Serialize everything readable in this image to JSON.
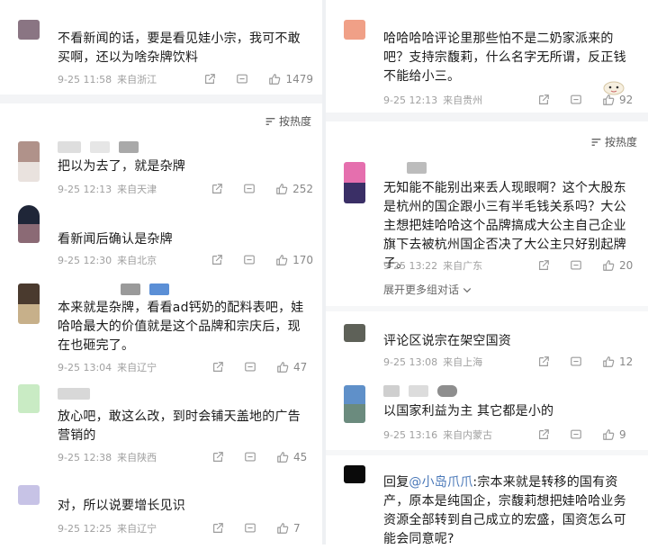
{
  "left": {
    "comments_top": [
      {
        "avatar_colors": [
          "#8a7583",
          "#8a7583"
        ],
        "text": "不看新闻的话，要是看见娃小宗，我可不敢买啊，还以为啥杂牌饮料",
        "date": "9-25 11:58",
        "location": "来自浙江",
        "likes": "1479"
      }
    ],
    "sort_label": "按热度",
    "comments": [
      {
        "avatar_colors": [
          "#b0928a",
          "#e9e2de"
        ],
        "text": "把以为去了，就是杂牌",
        "date": "9-25 12:13",
        "location": "来自天津",
        "likes": "252"
      },
      {
        "avatar_colors": [
          "#1f2638",
          "#8b6a75"
        ],
        "text": "看新闻后确认是杂牌",
        "date": "9-25 12:30",
        "location": "来自北京",
        "likes": "170"
      },
      {
        "avatar_colors": [
          "#4a3a2e",
          "#c7b08a"
        ],
        "text": "本来就是杂牌，看看ad钙奶的配料表吧，娃哈哈最大的价值就是这个品牌和宗庆后，现在也砸完了。",
        "date": "9-25 13:04",
        "location": "来自辽宁",
        "likes": "47"
      },
      {
        "avatar_colors": [
          "#c9ebc4",
          "#c9ebc4"
        ],
        "text": "放心吧，敢这么改，到时会铺天盖地的广告营销的",
        "date": "9-25 12:38",
        "location": "来自陕西",
        "likes": "45"
      },
      {
        "avatar_colors": [
          "#c7c3e6",
          "#c7c3e6"
        ],
        "text": "对，所以说要增长见识",
        "date": "9-25 12:25",
        "location": "来自辽宁",
        "likes": "7"
      }
    ]
  },
  "right": {
    "comments_top": [
      {
        "avatar_colors": [
          "#f0a087",
          "#f0a087"
        ],
        "text": "哈哈哈哈评论里那些怕不是二奶家派来的吧？支持宗馥莉，什么名字无所谓，反正钱不能给小三。",
        "date": "9-25 12:13",
        "location": "来自贵州",
        "likes": "92"
      }
    ],
    "sort_label": "按热度",
    "comments": [
      {
        "avatar_colors": [
          "#e56fae",
          "#3a2f66"
        ],
        "text": "无知能不能别出来丢人现眼啊？这个大股东是杭州的国企跟小三有半毛钱关系吗？大公主想把娃哈哈这个品牌搞成大公主自己企业旗下去被杭州国企否决了大公主只好别起牌子。",
        "date": "9-25 13:22",
        "location": "来自广东",
        "likes": "20",
        "expand": "展开更多组对话"
      },
      {
        "avatar_colors": [
          "#5e6158",
          "#5e6158"
        ],
        "text": "评论区说宗在架空国资",
        "date": "9-25 13:08",
        "location": "来自上海",
        "likes": "12"
      },
      {
        "avatar_colors": [
          "#5f90c9",
          "#6b8b7e"
        ],
        "text": "以国家利益为主 其它都是小的",
        "date": "9-25 13:16",
        "location": "来自内蒙古",
        "likes": "9"
      },
      {
        "avatar_colors": [
          "#0a0a0a",
          "#0a0a0a"
        ],
        "text": "回复@小岛爪爪:宗本来就是转移的国有资产，原本是纯国企，宗馥莉想把娃哈哈业务资源全部转到自己成立的宏盛，国资怎么可能会同意呢?",
        "mention": "@小岛爪爪",
        "date": "",
        "location": "",
        "likes": ""
      }
    ]
  },
  "icons": {
    "share": "share-icon",
    "comment": "comment-icon",
    "like": "thumbs-up-icon",
    "sort": "sort-icon",
    "chevron": "chevron-down-icon"
  }
}
